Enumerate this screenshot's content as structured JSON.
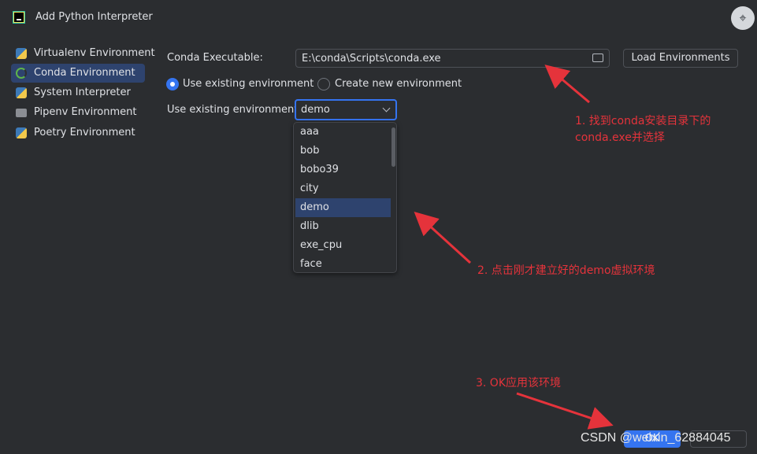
{
  "window": {
    "title": "Add Python Interpreter"
  },
  "sidebar": {
    "items": [
      {
        "label": "Virtualenv Environment",
        "icon": "python-icon",
        "selected": false
      },
      {
        "label": "Conda Environment",
        "icon": "conda-ring-icon",
        "selected": true
      },
      {
        "label": "System Interpreter",
        "icon": "python-icon",
        "selected": false
      },
      {
        "label": "Pipenv Environment",
        "icon": "folder-icon",
        "selected": false
      },
      {
        "label": "Poetry Environment",
        "icon": "python-icon",
        "selected": false
      }
    ]
  },
  "form": {
    "executable_label": "Conda Executable:",
    "executable_value": "E:\\conda\\Scripts\\conda.exe",
    "load_button": "Load Environments",
    "radio_existing": "Use existing environment",
    "radio_new": "Create new environment",
    "env_label": "Use existing environment:",
    "env_selected": "demo",
    "env_options": [
      "aaa",
      "bob",
      "bobo39",
      "city",
      "demo",
      "dlib",
      "exe_cpu",
      "face"
    ]
  },
  "annotations": {
    "note1_line1": "1. 找到conda安装目录下的",
    "note1_line2": "conda.exe并选择",
    "note2": "2. 点击刚才建立好的demo虚拟环境",
    "note3": "3. OK应用该环境",
    "color": "#e5333b"
  },
  "footer": {
    "ok": "OK",
    "watermark": "CSDN @weixin_62884045"
  },
  "colors": {
    "background": "#2b2d30",
    "accent": "#3574f0",
    "selection": "#2e436e"
  }
}
